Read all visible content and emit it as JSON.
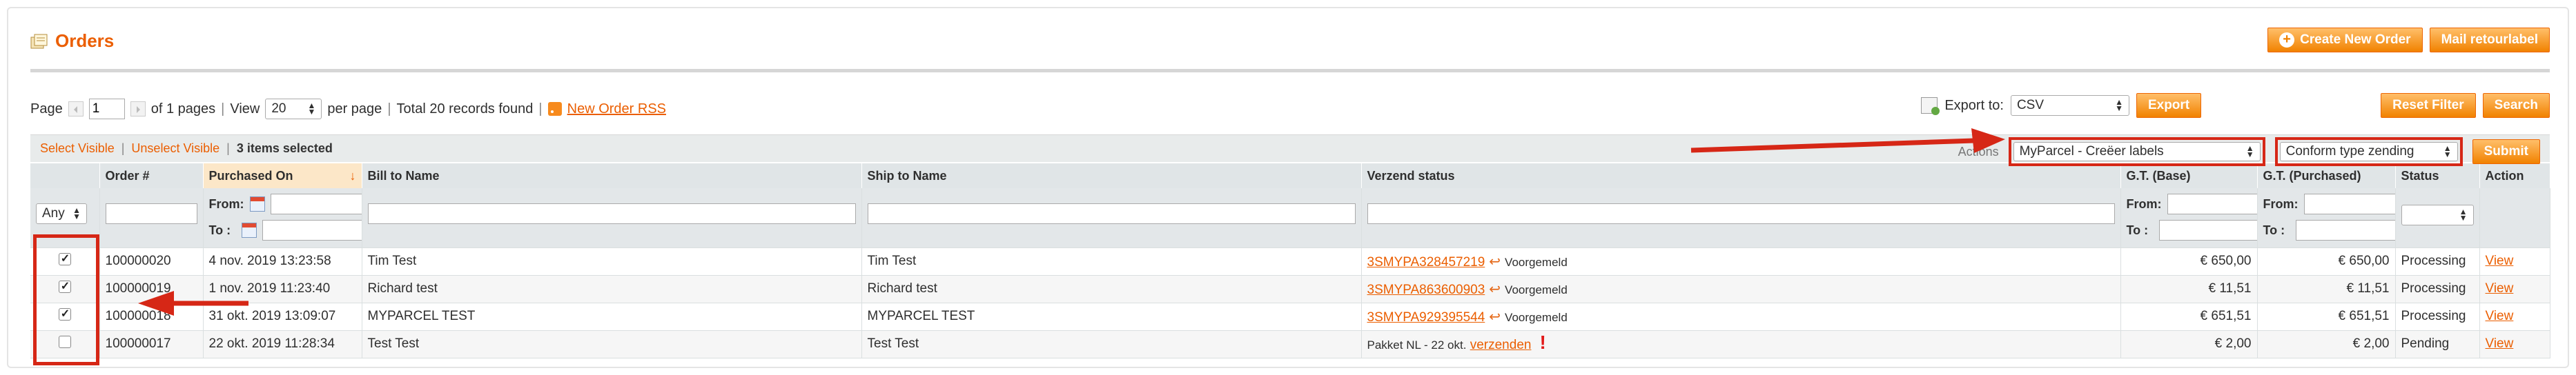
{
  "header": {
    "title": "Orders",
    "create_button": "Create New Order",
    "mail_button": "Mail retourlabel"
  },
  "pager": {
    "page_label": "Page",
    "page_value": "1",
    "of_pages": "of 1 pages",
    "view_label": "View",
    "per_page_value": "20",
    "per_page_label": "per page",
    "total": "Total 20 records found",
    "rss_link": "New Order RSS",
    "export_label": "Export to:",
    "export_format": "CSV",
    "export_button": "Export",
    "reset_button": "Reset Filter",
    "search_button": "Search"
  },
  "mass": {
    "select_visible": "Select Visible",
    "unselect_visible": "Unselect Visible",
    "selected": "3 items selected",
    "actions_label": "Actions",
    "action_value": "MyParcel - Creëer labels",
    "type_value": "Conform type zending",
    "submit": "Submit"
  },
  "columns": [
    "",
    "Order #",
    "Purchased On",
    "Bill to Name",
    "Ship to Name",
    "Verzend status",
    "G.T. (Base)",
    "G.T. (Purchased)",
    "Status",
    "Action"
  ],
  "filter": {
    "any": "Any",
    "from": "From:",
    "to": "To :"
  },
  "rows": [
    {
      "checked": true,
      "order": "100000020",
      "date": "4 nov. 2019 13:23:58",
      "bill": "Tim Test",
      "ship": "Tim Test",
      "track": "3SMYPA328457219",
      "state": "Voorgemeld",
      "base": "€ 650,00",
      "purchased": "€ 650,00",
      "status": "Processing",
      "action": "View"
    },
    {
      "checked": true,
      "order": "100000019",
      "date": "1 nov. 2019 11:23:40",
      "bill": "Richard test",
      "ship": "Richard test",
      "track": "3SMYPA863600903",
      "state": "Voorgemeld",
      "base": "€ 11,51",
      "purchased": "€ 11,51",
      "status": "Processing",
      "action": "View"
    },
    {
      "checked": true,
      "order": "100000018",
      "date": "31 okt. 2019 13:09:07",
      "bill": "MYPARCEL TEST",
      "ship": "MYPARCEL TEST",
      "track": "3SMYPA929395544",
      "state": "Voorgemeld",
      "base": "€ 651,51",
      "purchased": "€ 651,51",
      "status": "Processing",
      "action": "View"
    },
    {
      "checked": false,
      "order": "100000017",
      "date": "22 okt. 2019 11:28:34",
      "bill": "Test Test",
      "ship": "Test Test",
      "pakket": "Pakket NL - 22 okt.",
      "send_link": "verzenden",
      "base": "€ 2,00",
      "purchased": "€ 2,00",
      "status": "Pending",
      "action": "View"
    }
  ],
  "colors": {
    "accent": "#eb5e00",
    "button": "#f18200",
    "annotation": "#d62716"
  }
}
